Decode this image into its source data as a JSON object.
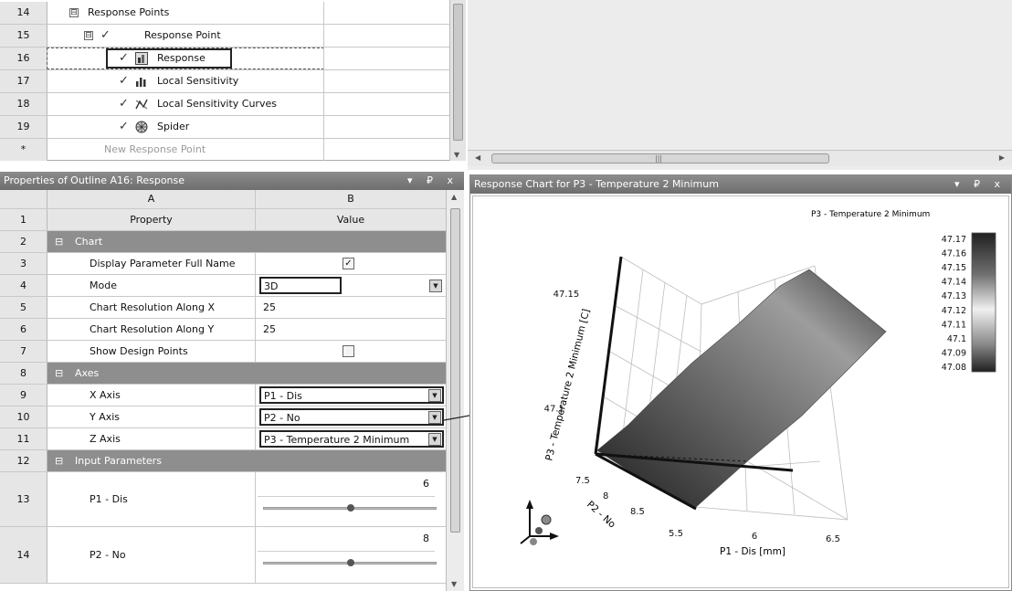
{
  "outline": {
    "rows": [
      {
        "num": "14",
        "label": "Response Points",
        "toggle": "⊟"
      },
      {
        "num": "15",
        "label": "Response Point",
        "toggle": "⊟",
        "check": "✓"
      },
      {
        "num": "16",
        "label": "Response",
        "check": "✓"
      },
      {
        "num": "17",
        "label": "Local Sensitivity",
        "check": "✓"
      },
      {
        "num": "18",
        "label": "Local Sensitivity Curves",
        "check": "✓"
      },
      {
        "num": "19",
        "label": "Spider",
        "check": "✓"
      },
      {
        "num": "*",
        "label": "New Response Point"
      }
    ]
  },
  "properties": {
    "title": "Properties of Outline A16: Response",
    "title_buttons": "▾ ₽ x",
    "col_a": "A",
    "col_b": "B",
    "header": {
      "num": "1",
      "a": "Property",
      "b": "Value"
    },
    "sections": {
      "chart": {
        "num": "2",
        "toggle": "⊟",
        "label": "Chart"
      },
      "axes": {
        "num": "8",
        "toggle": "⊟",
        "label": "Axes"
      },
      "inputs": {
        "num": "12",
        "toggle": "⊟",
        "label": "Input Parameters"
      }
    },
    "rows": {
      "display_full_name": {
        "num": "3",
        "label": "Display Parameter Full Name",
        "checked": "✓"
      },
      "mode": {
        "num": "4",
        "label": "Mode",
        "value": "3D"
      },
      "res_x": {
        "num": "5",
        "label": "Chart Resolution Along X",
        "value": "25"
      },
      "res_y": {
        "num": "6",
        "label": "Chart Resolution Along Y",
        "value": "25"
      },
      "show_dp": {
        "num": "7",
        "label": "Show Design Points",
        "checked": ""
      },
      "x_axis": {
        "num": "9",
        "label": "X Axis",
        "value": "P1 - Dis"
      },
      "y_axis": {
        "num": "10",
        "label": "Y Axis",
        "value": "P2 - No"
      },
      "z_axis": {
        "num": "11",
        "label": "Z Axis",
        "value": "P3 - Temperature 2 Minimum"
      },
      "p1": {
        "num": "13",
        "label": "P1 - Dis",
        "value": "6",
        "slider_fraction": 0.5
      },
      "p2": {
        "num": "14",
        "label": "P2 - No",
        "value": "8",
        "slider_fraction": 0.5
      }
    },
    "dropdown_arrow": "▼"
  },
  "chart_panel": {
    "title": "Response Chart for P3 - Temperature 2 Minimum",
    "title_buttons": "▾ ₽ x"
  },
  "chart_data": {
    "type": "surface",
    "title": "P3 - Temperature 2 Minimum",
    "xlabel": "P1 - Dis  [mm]",
    "ylabel": "P2 - No",
    "zlabel": "P3 - Temperature 2 Minimum  [C]",
    "x_ticks": [
      "5.5",
      "6",
      "6.5"
    ],
    "y_ticks": [
      "7.5",
      "8",
      "8.5"
    ],
    "z_ticks": [
      "47.15",
      "47.1"
    ],
    "colorbar_ticks": [
      "47.17",
      "47.16",
      "47.15",
      "47.14",
      "47.13",
      "47.12",
      "47.11",
      "47.1",
      "47.09",
      "47.08"
    ],
    "zlim": [
      47.08,
      47.17
    ],
    "xlim": [
      5.5,
      6.5
    ],
    "ylim": [
      7.5,
      8.5
    ],
    "surface_z_range": [
      47.08,
      47.17
    ],
    "grid": true,
    "legend_position": "top-right"
  },
  "colors": {
    "titlebar": "#7a7a7a",
    "section": "#8e8e8e",
    "header_cell": "#e6e6e6",
    "surface_dark": "#2a2a2a",
    "surface_light": "#b0b0b0"
  }
}
